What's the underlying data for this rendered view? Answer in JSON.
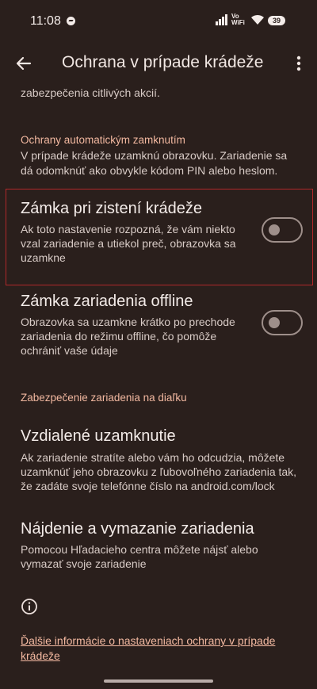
{
  "status": {
    "time": "11:08",
    "vowifi_top": "Vo",
    "vowifi_bottom": "WiFi",
    "battery": "39"
  },
  "app_bar": {
    "title": "Ochrana v prípade krádeže"
  },
  "content": {
    "top_partial": "zabezpečenia citlivých akcií.",
    "auto_lock": {
      "header": "Ochrany automatickým zamknutím",
      "description_lines": [
        "V prípade krádeže uzamknú obrazovku. Zariadenie sa",
        "dá odomknúť ako obvykle kódom PIN alebo heslom."
      ]
    },
    "theft_lock": {
      "title": "Zámka pri zistení krádeže",
      "desc_lines": [
        "Ak toto nastavenie rozpozná, že vám niekto",
        "vzal zariadenie a utiekol preč, obrazovka sa",
        "uzamkne"
      ],
      "enabled": false
    },
    "offline_lock": {
      "title": "Zámka zariadenia offline",
      "desc_lines": [
        "Obrazovka sa uzamkne krátko po prechode",
        "zariadenia do režimu offline, čo pomôže",
        "ochrániť vaše údaje"
      ],
      "enabled": false
    },
    "remote": {
      "header": "Zabezpečenie zariadenia na diaľku",
      "remote_lock": {
        "title": "Vzdialené uzamknutie",
        "desc_lines": [
          "Ak zariadenie stratíte alebo vám ho odcudzia, môžete",
          "uzamknúť jeho obrazovku z ľubovoľného zariadenia tak,",
          "že zadáte svoje telefónne číslo na android.com/lock"
        ]
      },
      "find_erase": {
        "title": "Nájdenie a vymazanie zariadenia",
        "desc_lines": [
          "Pomocou Hľadacieho centra môžete nájsť alebo",
          "vymazať svoje zariadenie"
        ]
      }
    },
    "more_info_link": "Ďalšie informácie o nastaveniach ochrany v prípade krádeže"
  },
  "colors": {
    "background": "#2a1f1c",
    "accent": "#f2b8a0",
    "highlight_border": "#b0282a"
  },
  "icons": {
    "back": "arrow-back-icon",
    "more": "more-vert-icon",
    "info": "info-icon"
  }
}
